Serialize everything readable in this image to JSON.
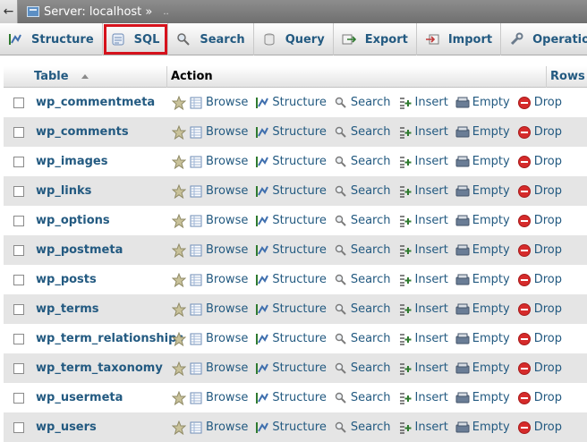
{
  "topbar": {
    "crumb": "Server: localhost »",
    "extra": ".."
  },
  "tabs": [
    {
      "key": "structure",
      "label": "Structure",
      "icon": "structure-icon"
    },
    {
      "key": "sql",
      "label": "SQL",
      "icon": "sql-icon",
      "selected": true
    },
    {
      "key": "search",
      "label": "Search",
      "icon": "search-icon"
    },
    {
      "key": "query",
      "label": "Query",
      "icon": "query-icon"
    },
    {
      "key": "export",
      "label": "Export",
      "icon": "export-icon"
    },
    {
      "key": "import",
      "label": "Import",
      "icon": "import-icon"
    },
    {
      "key": "operations",
      "label": "Operations",
      "icon": "operations-icon"
    }
  ],
  "table": {
    "headers": {
      "table": "Table",
      "action": "Action",
      "rows": "Rows"
    },
    "actions": {
      "browse": "Browse",
      "structure": "Structure",
      "search": "Search",
      "insert": "Insert",
      "empty": "Empty",
      "drop": "Drop"
    },
    "rows": [
      "wp_commentmeta",
      "wp_comments",
      "wp_images",
      "wp_links",
      "wp_options",
      "wp_postmeta",
      "wp_posts",
      "wp_terms",
      "wp_term_relationships",
      "wp_term_taxonomy",
      "wp_usermeta",
      "wp_users"
    ]
  },
  "colors": {
    "link": "#235a81",
    "highlight": "#d6121c",
    "drop": "#d62b2b"
  }
}
